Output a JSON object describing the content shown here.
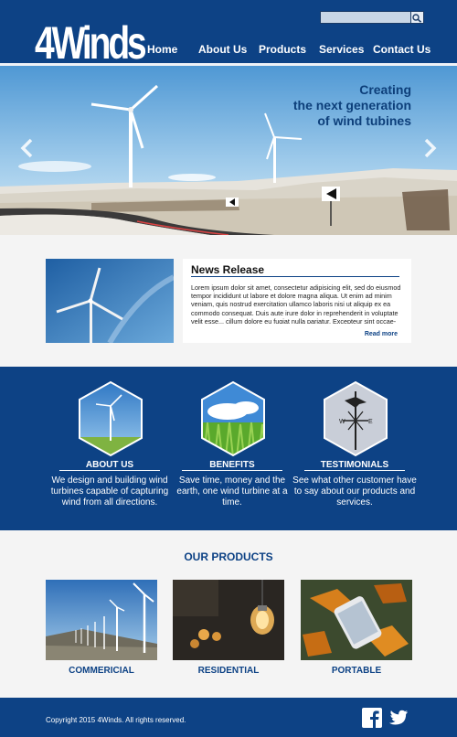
{
  "header": {
    "logo": "4Winds",
    "search": {
      "value": "",
      "placeholder": "",
      "icon": "search-icon"
    },
    "nav": [
      {
        "label": "Home"
      },
      {
        "label": "About Us"
      },
      {
        "label": "Products"
      },
      {
        "label": "Services"
      },
      {
        "label": "Contact Us"
      }
    ]
  },
  "hero": {
    "headline": [
      "Creating",
      "the next generation",
      "of wind tubines"
    ],
    "prev_icon": "chevron-left-icon",
    "next_icon": "chevron-right-icon"
  },
  "news": {
    "title": "News Release",
    "body": "Lorem ipsum dolor sit amet, consectetur adipisicing elit, sed do eiusmod tempor incididunt ut labore et dolore magna aliqua. Ut enim ad minim veniam, quis nostrud exercitation ullamco laboris nisi ut aliquip ex ea commodo consequat. Duis aute irure dolor in reprehenderit in voluptate velit esse... cillum dolore eu fugiat nulla pariatur. Excepteur sint occae-",
    "more": "Read more"
  },
  "features": [
    {
      "title": "ABOUT US",
      "text": "We design and building wind turbines capable of capturing wind from all directions."
    },
    {
      "title": "BENEFITS",
      "text": "Save time, money and the earth, one wind turbine at a time."
    },
    {
      "title": "TESTIMONIALS",
      "text": "See what other customer have to say about our products and services."
    }
  ],
  "products": {
    "heading": "OUR PRODUCTS",
    "items": [
      {
        "label": "COMMERICIAL"
      },
      {
        "label": "RESIDENTIAL"
      },
      {
        "label": "PORTABLE"
      }
    ]
  },
  "footer": {
    "copyright": "Copyright 2015 4Winds. All rights reserved.",
    "social": [
      "facebook-icon",
      "twitter-icon"
    ]
  },
  "colors": {
    "brand_blue": "#0d4285",
    "header_text": "#ffffff",
    "page_background": "#f4f4f4"
  }
}
